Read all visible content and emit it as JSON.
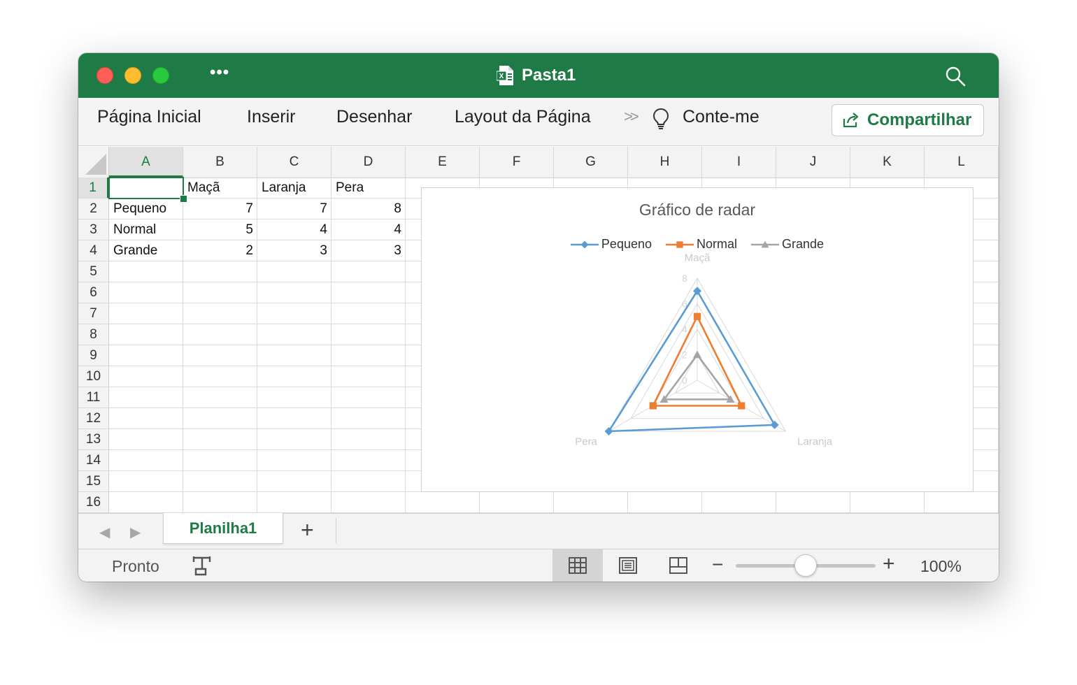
{
  "window": {
    "title": "Pasta1",
    "file_icon": "excel-file-icon"
  },
  "ribbon": {
    "tabs": [
      "Página Inicial",
      "Inserir",
      "Desenhar",
      "Layout da Página"
    ],
    "overflow": ">>",
    "tell_me": "Conte-me",
    "share_label": "Compartilhar"
  },
  "sheet": {
    "columns": [
      "A",
      "B",
      "C",
      "D",
      "E",
      "F",
      "G",
      "H",
      "I",
      "J",
      "K",
      "L"
    ],
    "active_column": "A",
    "rows": [
      "1",
      "2",
      "3",
      "4",
      "5",
      "6",
      "7",
      "8",
      "9",
      "10",
      "11",
      "12",
      "13",
      "14",
      "15",
      "16"
    ],
    "active_row": "1",
    "header_row": [
      "",
      "Maçã",
      "Laranja",
      "Pera"
    ],
    "data_rows": [
      [
        "Pequeno",
        "7",
        "7",
        "8"
      ],
      [
        "Normal",
        "5",
        "4",
        "4"
      ],
      [
        "Grande",
        "2",
        "3",
        "3"
      ]
    ]
  },
  "chart_data": {
    "type": "radar",
    "title": "Gráfico de radar",
    "categories": [
      "Maçã",
      "Laranja",
      "Pera"
    ],
    "series": [
      {
        "name": "Pequeno",
        "values": [
          7,
          7,
          8
        ],
        "color": "#5b9bd5",
        "marker": "diamond"
      },
      {
        "name": "Normal",
        "values": [
          5,
          4,
          4
        ],
        "color": "#ed7d31",
        "marker": "square"
      },
      {
        "name": "Grande",
        "values": [
          2,
          3,
          3
        ],
        "color": "#a5a5a5",
        "marker": "triangle"
      }
    ],
    "radial_ticks": [
      "0",
      "2",
      "4",
      "6",
      "8"
    ],
    "rmax": 8,
    "legend_position": "top"
  },
  "tabs_bar": {
    "sheet_name": "Planilha1",
    "add_label": "+"
  },
  "status": {
    "ready": "Pronto",
    "zoom": "100%",
    "zoom_fraction": 0.5
  }
}
